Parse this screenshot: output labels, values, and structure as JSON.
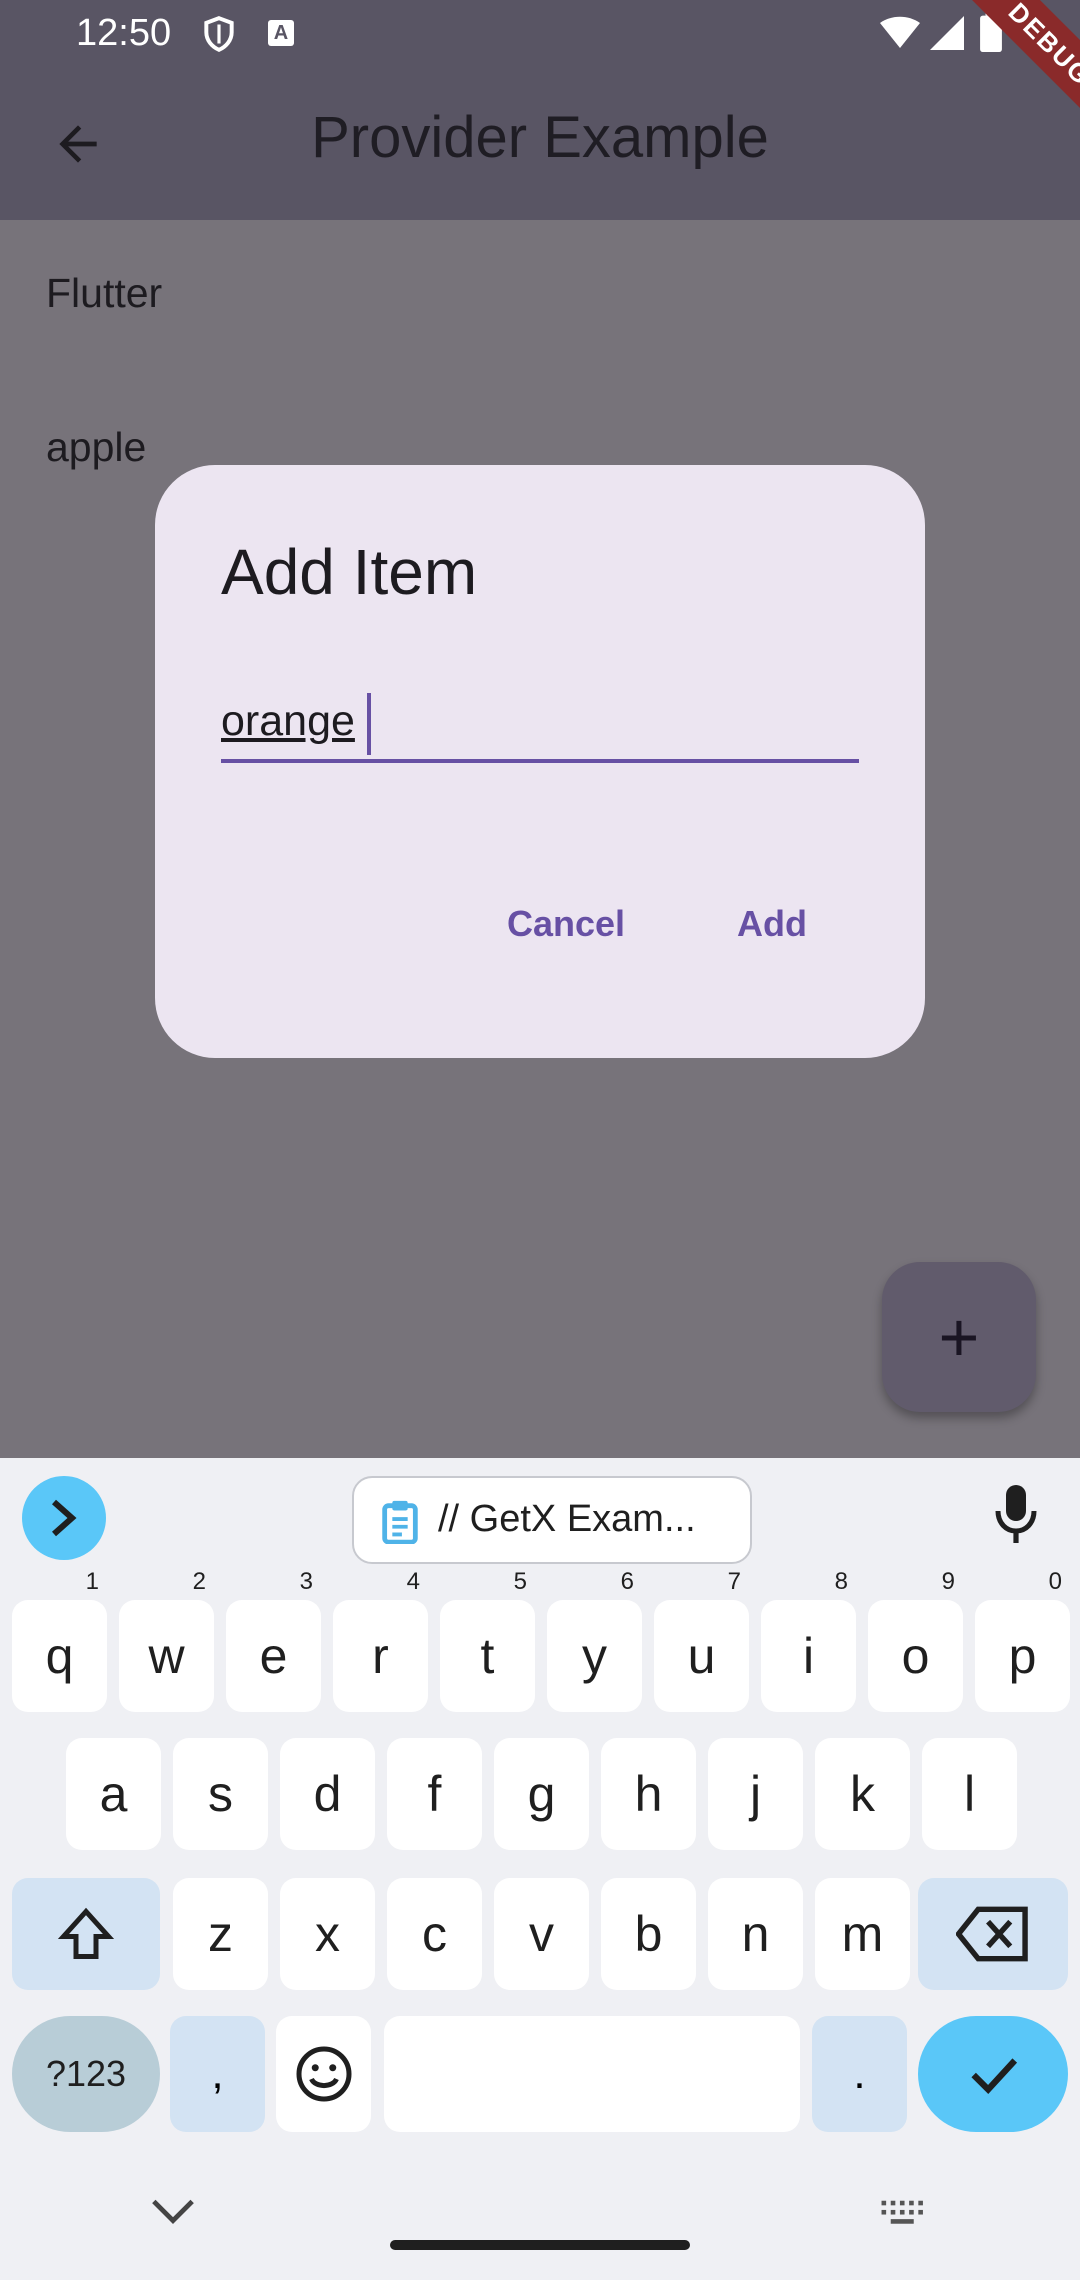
{
  "status_bar": {
    "time": "12:50",
    "a_badge": "A"
  },
  "debug_banner": "DEBUG",
  "app_bar": {
    "title": "Provider Example"
  },
  "list": {
    "items": [
      "Flutter",
      "apple"
    ]
  },
  "dialog": {
    "title": "Add Item",
    "input_value": "orange",
    "cancel_label": "Cancel",
    "add_label": "Add"
  },
  "fab": {
    "label": "+"
  },
  "keyboard": {
    "clipboard_suggestion": "// GetX Exam...",
    "row1": [
      {
        "key": "q",
        "num": "1"
      },
      {
        "key": "w",
        "num": "2"
      },
      {
        "key": "e",
        "num": "3"
      },
      {
        "key": "r",
        "num": "4"
      },
      {
        "key": "t",
        "num": "5"
      },
      {
        "key": "y",
        "num": "6"
      },
      {
        "key": "u",
        "num": "7"
      },
      {
        "key": "i",
        "num": "8"
      },
      {
        "key": "o",
        "num": "9"
      },
      {
        "key": "p",
        "num": "0"
      }
    ],
    "row2": [
      "a",
      "s",
      "d",
      "f",
      "g",
      "h",
      "j",
      "k",
      "l"
    ],
    "row3": [
      "z",
      "x",
      "c",
      "v",
      "b",
      "n",
      "m"
    ],
    "numsym_label": "?123",
    "comma_label": ",",
    "period_label": "."
  },
  "colors": {
    "app_bar": "#595564",
    "scrim": "#77737a",
    "dialog_bg": "#ece5f1",
    "accent": "#6750a4",
    "keyboard_accent": "#5ac7f8"
  }
}
